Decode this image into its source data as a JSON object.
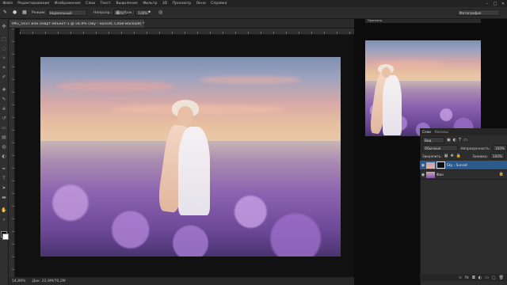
{
  "menu": {
    "items": [
      "Файл",
      "Редактирование",
      "Изображение",
      "Слои",
      "Текст",
      "Выделение",
      "Фильтр",
      "3D",
      "Просмотр",
      "Окно",
      "Справка"
    ],
    "window_buttons": [
      "–",
      "□",
      "×"
    ]
  },
  "options": {
    "mode_label": "Режим:",
    "mode_value": "Нормальный",
    "opacity_label": "Непрозр.:",
    "opacity_value": "80%",
    "flow_label": "Наж.:",
    "flow_value": "100%",
    "workspace_value": "Фотография"
  },
  "document": {
    "tab_title": "IMG_5037 или смарт-объект-1 @ 54,9% (Sky - Sunset, Слой-маска/8) *",
    "zoom": "54,89%",
    "doc_info": "Док: 22,9M/70,2M"
  },
  "preview_tab": "Просмотр",
  "layers": {
    "tabs": [
      "Слои",
      "Каналы"
    ],
    "filter_label": "Вид",
    "blend_mode": "Обычные",
    "opacity_label": "Непрозрачность:",
    "opacity_value": "100%",
    "lock_label": "Закрепить:",
    "fill_label": "Заливка:",
    "fill_value": "100%",
    "items": [
      {
        "name": "Sky - Sunset",
        "selected": true
      },
      {
        "name": "Фон",
        "selected": false
      }
    ]
  },
  "colors": {
    "accent": "#2d5a8c",
    "panel": "#2d2d2d"
  }
}
